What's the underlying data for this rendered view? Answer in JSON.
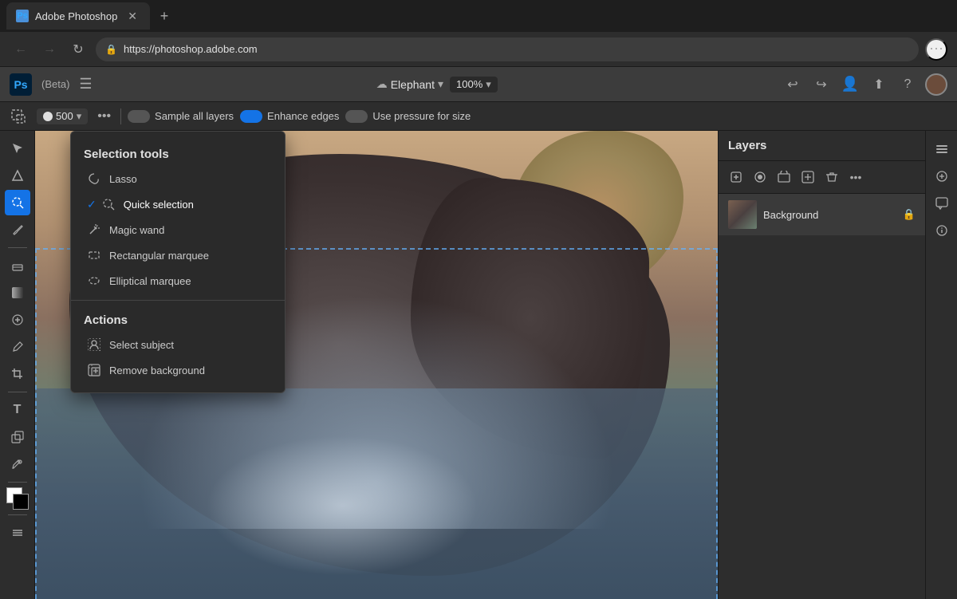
{
  "browser": {
    "tab_title": "Adobe Photoshop",
    "tab_favicon": "Ps",
    "url": "https://photoshop.adobe.com",
    "new_tab_label": "+",
    "nav": {
      "back": "←",
      "forward": "→",
      "refresh": "↻",
      "more": "⋯"
    }
  },
  "app": {
    "logo": "Ps",
    "beta_label": "(Beta)",
    "hamburger": "☰",
    "file_name": "Elephant",
    "zoom_level": "100%",
    "header_actions": {
      "undo": "↩",
      "redo": "↪",
      "share": "⬆",
      "help": "?",
      "account": "👤"
    }
  },
  "toolbar_options": {
    "brush_size": "500",
    "more_dots": "•••",
    "sample_all_layers_label": "Sample all layers",
    "enhance_edges_label": "Enhance edges",
    "use_pressure_label": "Use pressure for size"
  },
  "dropdown_panel": {
    "section_title": "Selection tools",
    "items": [
      {
        "label": "Lasso",
        "active": false,
        "icon": "lasso"
      },
      {
        "label": "Quick selection",
        "active": true,
        "icon": "quick-selection"
      },
      {
        "label": "Magic wand",
        "active": false,
        "icon": "magic-wand"
      },
      {
        "label": "Rectangular marquee",
        "active": false,
        "icon": "rect-marquee"
      },
      {
        "label": "Elliptical marquee",
        "active": false,
        "icon": "ellipse-marquee"
      }
    ],
    "actions_title": "Actions",
    "actions": [
      {
        "label": "Select subject",
        "icon": "select-subject"
      },
      {
        "label": "Remove background",
        "icon": "remove-bg"
      }
    ]
  },
  "layers": {
    "title": "Layers",
    "items": [
      {
        "name": "Background",
        "locked": true
      }
    ],
    "toolbar_buttons": [
      "add",
      "mask",
      "shape",
      "adjustment",
      "delete",
      "more"
    ]
  }
}
